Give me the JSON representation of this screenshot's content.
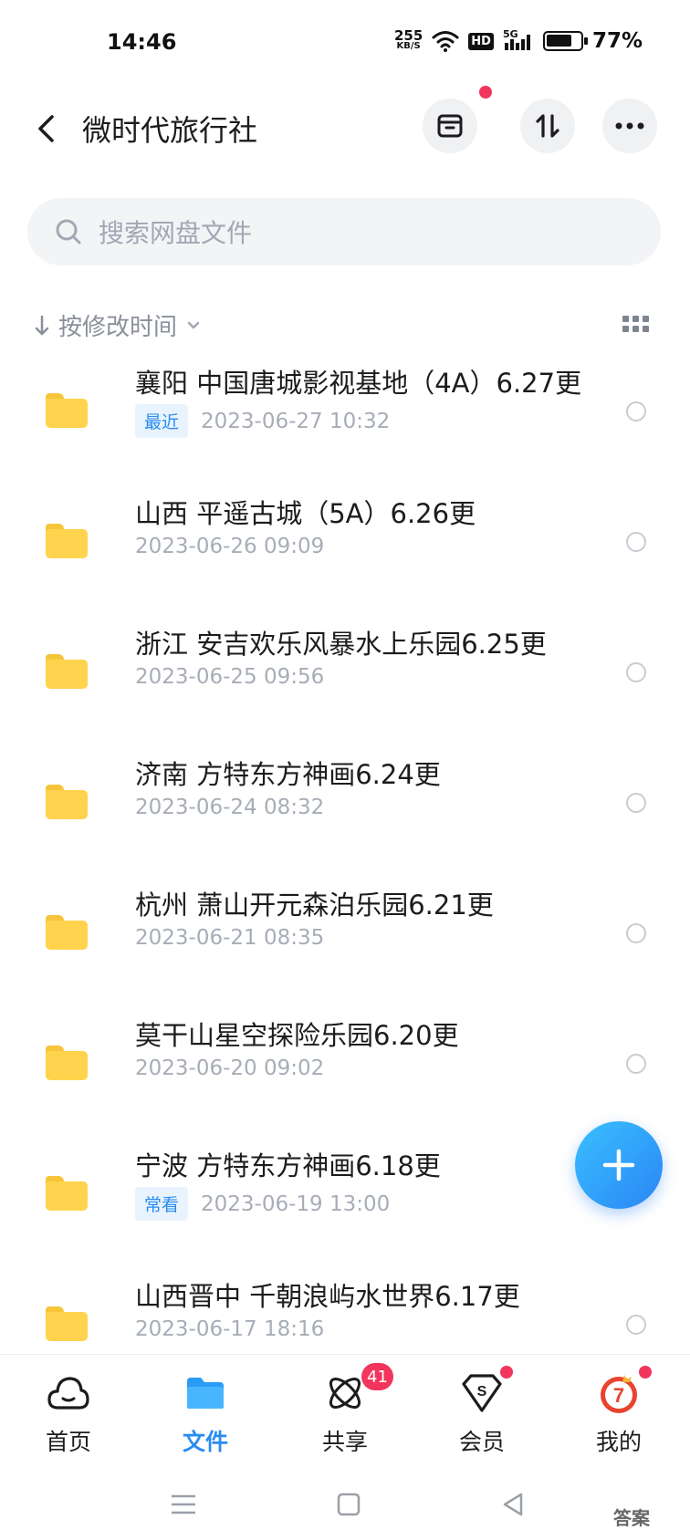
{
  "status_bar": {
    "time": "14:46",
    "net_speed_value": "255",
    "net_speed_unit": "KB/S",
    "hd_label": "HD",
    "signal_label": "5G",
    "battery_percent": "77%",
    "battery_level": 0.77
  },
  "header": {
    "title": "微时代旅行社",
    "back_icon": "chevron-left-icon",
    "buttons": [
      "archive-icon",
      "sort-arrows-icon",
      "more-icon"
    ]
  },
  "search": {
    "placeholder": "搜索网盘文件"
  },
  "sort": {
    "label": "按修改时间"
  },
  "files": [
    {
      "name": "襄阳 中国唐城影视基地（4A）6.27更",
      "tag": "最近",
      "date": "2023-06-27  10:32"
    },
    {
      "name": "山西  平遥古城（5A）6.26更",
      "tag": "",
      "date": "2023-06-26  09:09"
    },
    {
      "name": "浙江 安吉欢乐风暴水上乐园6.25更",
      "tag": "",
      "date": "2023-06-25  09:56"
    },
    {
      "name": "济南 方特东方神画6.24更",
      "tag": "",
      "date": "2023-06-24  08:32"
    },
    {
      "name": "杭州 萧山开元森泊乐园6.21更",
      "tag": "",
      "date": "2023-06-21  08:35"
    },
    {
      "name": "莫干山星空探险乐园6.20更",
      "tag": "",
      "date": "2023-06-20  09:02"
    },
    {
      "name": "宁波 方特东方神画6.18更",
      "tag": "常看",
      "date": "2023-06-19  13:00"
    },
    {
      "name": "山西晋中 千朝浪屿水世界6.17更",
      "tag": "",
      "date": "2023-06-17  18:16"
    }
  ],
  "tabbar": {
    "items": [
      {
        "label": "首页",
        "icon": "cloud-face-icon"
      },
      {
        "label": "文件",
        "icon": "folder-icon"
      },
      {
        "label": "共享",
        "icon": "atom-share-icon"
      },
      {
        "label": "会员",
        "icon": "vip-diamond-icon"
      },
      {
        "label": "我的",
        "icon": "avatar-icon"
      }
    ],
    "share_badge": "41"
  },
  "watermark": "答案",
  "colors": {
    "accent": "#2a8cf0",
    "folder": "#ffd34d",
    "badge": "#f2355c"
  }
}
